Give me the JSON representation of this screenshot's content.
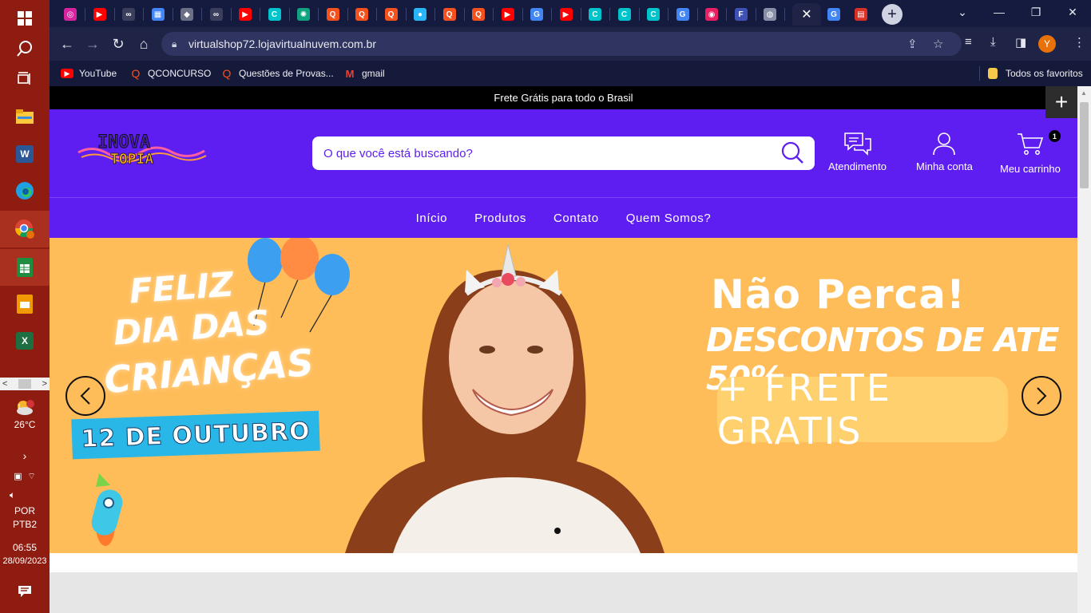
{
  "taskbar": {
    "weather": {
      "temp": "26°C",
      "badge": "1"
    },
    "language": {
      "line1": "POR",
      "line2": "PTB2"
    },
    "clock": {
      "time": "06:55",
      "date": "28/09/2023"
    }
  },
  "browser": {
    "url": "virtualshop72.lojavirtualnuvem.com.br",
    "profile_initial": "Y",
    "tabs": [
      {
        "icon": "instagram-icon",
        "color": "#d6249f"
      },
      {
        "icon": "youtube-icon",
        "color": "#ff0000"
      },
      {
        "icon": "chain-link-icon",
        "color": "#3b3f5c"
      },
      {
        "icon": "apps-grid-icon",
        "color": "#4285f4"
      },
      {
        "icon": "layers-icon",
        "color": "#6b7087"
      },
      {
        "icon": "chain-link-icon",
        "color": "#3b3f5c"
      },
      {
        "icon": "youtube-icon",
        "color": "#ff0000"
      },
      {
        "icon": "canva-icon",
        "color": "#00c4cc"
      },
      {
        "icon": "chatgpt-icon",
        "color": "#10a37f"
      },
      {
        "icon": "qconcursos-icon",
        "color": "#f4511e"
      },
      {
        "icon": "qconcursos-icon",
        "color": "#f4511e"
      },
      {
        "icon": "qconcursos-icon",
        "color": "#f4511e"
      },
      {
        "icon": "circle-app-icon",
        "color": "#29b6f6"
      },
      {
        "icon": "qconcursos-icon",
        "color": "#f4511e"
      },
      {
        "icon": "qconcursos-icon",
        "color": "#f4511e"
      },
      {
        "icon": "youtube-icon",
        "color": "#ff0000"
      },
      {
        "icon": "google-icon",
        "color": "#4285f4"
      },
      {
        "icon": "youtube-icon",
        "color": "#ff0000"
      },
      {
        "icon": "canva-icon",
        "color": "#00c4cc"
      },
      {
        "icon": "canva-icon",
        "color": "#00c4cc"
      },
      {
        "icon": "canva-icon",
        "color": "#00c4cc"
      },
      {
        "icon": "google-icon",
        "color": "#4285f4"
      },
      {
        "icon": "drop-icon",
        "color": "#e91e63"
      },
      {
        "icon": "forms-icon",
        "color": "#3f51b5"
      },
      {
        "icon": "chrome-icon",
        "color": "#8a8fa8"
      }
    ],
    "bookmarks": [
      {
        "label": "YouTube",
        "icon": "youtube-icon"
      },
      {
        "label": "QCONCURSO",
        "icon": "qconcursos-icon"
      },
      {
        "label": "Questões de Provas...",
        "icon": "qconcursos-icon"
      },
      {
        "label": "gmail",
        "icon": "gmail-icon"
      }
    ],
    "all_bookmarks_label": "Todos os favoritos"
  },
  "store": {
    "announcement": "Frete Grátis para todo o Brasil",
    "logo_text": {
      "line1": "INOVA",
      "line2": "TOPIA"
    },
    "search_placeholder": "O que você está buscando?",
    "header_actions": {
      "support": "Atendimento",
      "account": "Minha conta",
      "cart": "Meu carrinho",
      "cart_count": "1"
    },
    "nav": [
      "Início",
      "Produtos",
      "Contato",
      "Quem Somos?"
    ],
    "banner": {
      "line1": "FELIZ",
      "line2": "DIA DAS",
      "line3": "CRIANÇAS",
      "date": "12 DE OUTUBRO",
      "headline": "Não Perca!",
      "discount": "DESCONTOS DE ATE 50%",
      "shipping": "+ FRETE GRATIS"
    },
    "colors": {
      "brand": "#5e1ef2",
      "banner_bg": "#ffbd5a"
    }
  }
}
